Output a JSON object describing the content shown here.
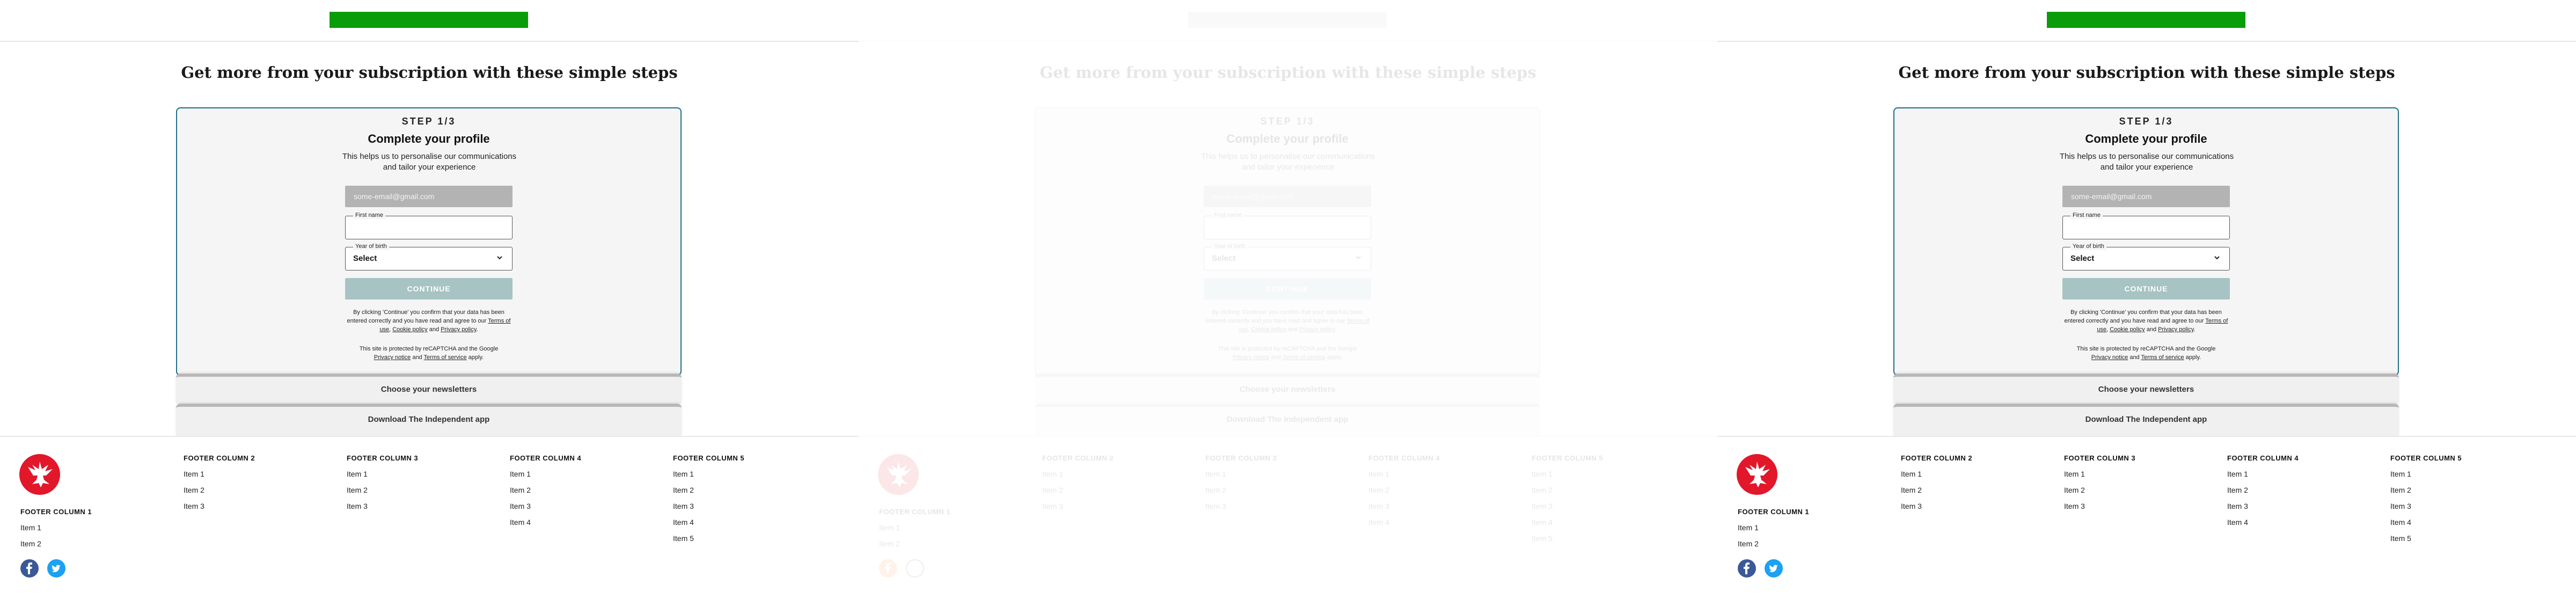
{
  "panels": [
    {
      "heading": "Get more from your subscription with these simple steps",
      "step_label": "STEP 1/3",
      "card_title": "Complete your profile",
      "card_subtitle": "This helps us to personalise our communications and tailor your experience",
      "email_value": "some-email@gmail.com",
      "first_name_label": "First name",
      "first_name_value": "",
      "year_label": "Year of birth",
      "year_value": "Select",
      "continue_label": "CONTINUE",
      "legal_prefix": "By clicking 'Continue' you confirm that your data has been entered correctly and you have read and agree to our ",
      "legal_terms": "Terms of use",
      "legal_sep1": ", ",
      "legal_cookie": "Cookie policy",
      "legal_and": " and ",
      "legal_privacy": "Privacy policy",
      "legal_end": ".",
      "captcha_prefix": "This site is protected by reCAPTCHA and the Google ",
      "captcha_privacy": "Privacy notice",
      "captcha_and": " and ",
      "captcha_terms": "Terms of service",
      "captcha_end": " apply.",
      "accordion_newsletters": "Choose your newsletters",
      "accordion_app": "Download The Independent app",
      "footer": {
        "col1": {
          "title": "FOOTER COLUMN 1",
          "items": [
            "Item 1",
            "Item 2"
          ]
        },
        "col2": {
          "title": "FOOTER COLUMN 2",
          "items": [
            "Item 1",
            "Item 2",
            "Item 3"
          ]
        },
        "col3": {
          "title": "FOOTER COLUMN 3",
          "items": [
            "Item 1",
            "Item 2",
            "Item 3"
          ]
        },
        "col4": {
          "title": "FOOTER COLUMN 4",
          "items": [
            "Item 1",
            "Item 2",
            "Item 3",
            "Item 4"
          ]
        },
        "col5": {
          "title": "FOOTER COLUMN 5",
          "items": [
            "Item 1",
            "Item 2",
            "Item 3",
            "Item 4",
            "Item 5"
          ]
        }
      }
    },
    {
      "heading": "Get more from your subscription with these simple steps",
      "step_label": "STEP 1/3",
      "card_title": "Complete your profile",
      "card_subtitle": "This helps us to personalise our communications and tailor your experience",
      "email_value": "some-email@gmail.com",
      "first_name_label": "First name",
      "first_name_value": "",
      "year_label": "Year of birth",
      "year_value": "Select",
      "continue_label": "CONTINUE",
      "legal_prefix": "By clicking 'Continue' you confirm that your data has been entered correctly and you have read and agree to our ",
      "legal_terms": "Terms of use",
      "legal_sep1": ", ",
      "legal_cookie": "Cookie policy",
      "legal_and": " and ",
      "legal_privacy": "Privacy policy",
      "legal_end": ".",
      "captcha_prefix": "This site is protected by reCAPTCHA and the Google ",
      "captcha_privacy": "Privacy notice",
      "captcha_and": " and ",
      "captcha_terms": "Terms of service",
      "captcha_end": " apply.",
      "accordion_newsletters": "Choose your newsletters",
      "accordion_app": "Download The Independent app",
      "footer": {
        "col1": {
          "title": "FOOTER COLUMN 1",
          "items": [
            "Item 1",
            "Item 2"
          ]
        },
        "col2": {
          "title": "FOOTER COLUMN 2",
          "items": [
            "Item 1",
            "Item 2",
            "Item 3"
          ]
        },
        "col3": {
          "title": "FOOTER COLUMN 3",
          "items": [
            "Item 1",
            "Item 2",
            "Item 3"
          ]
        },
        "col4": {
          "title": "FOOTER COLUMN 4",
          "items": [
            "Item 1",
            "Item 2",
            "Item 3",
            "Item 4"
          ]
        },
        "col5": {
          "title": "FOOTER COLUMN 5",
          "items": [
            "Item 1",
            "Item 2",
            "Item 3",
            "Item 4",
            "Item 5"
          ]
        }
      }
    },
    {
      "heading": "Get more from your subscription with these simple steps",
      "step_label": "STEP 1/3",
      "card_title": "Complete your profile",
      "card_subtitle": "This helps us to personalise our communications and tailor your experience",
      "email_value": "some-email@gmail.com",
      "first_name_label": "First name",
      "first_name_value": "",
      "year_label": "Year of birth",
      "year_value": "Select",
      "continue_label": "CONTINUE",
      "legal_prefix": "By clicking 'Continue' you confirm that your data has been entered correctly and you have read and agree to our ",
      "legal_terms": "Terms of use",
      "legal_sep1": ", ",
      "legal_cookie": "Cookie policy",
      "legal_and": " and ",
      "legal_privacy": "Privacy policy",
      "legal_end": ".",
      "captcha_prefix": "This site is protected by reCAPTCHA and the Google ",
      "captcha_privacy": "Privacy notice",
      "captcha_and": " and ",
      "captcha_terms": "Terms of service",
      "captcha_end": " apply.",
      "accordion_newsletters": "Choose your newsletters",
      "accordion_app": "Download The Independent app",
      "footer": {
        "col1": {
          "title": "FOOTER COLUMN 1",
          "items": [
            "Item 1",
            "Item 2"
          ]
        },
        "col2": {
          "title": "FOOTER COLUMN 2",
          "items": [
            "Item 1",
            "Item 2",
            "Item 3"
          ]
        },
        "col3": {
          "title": "FOOTER COLUMN 3",
          "items": [
            "Item 1",
            "Item 2",
            "Item 3"
          ]
        },
        "col4": {
          "title": "FOOTER COLUMN 4",
          "items": [
            "Item 1",
            "Item 2",
            "Item 3",
            "Item 4"
          ]
        },
        "col5": {
          "title": "FOOTER COLUMN 5",
          "items": [
            "Item 1",
            "Item 2",
            "Item 3",
            "Item 4",
            "Item 5"
          ]
        }
      }
    }
  ],
  "colors": {
    "brand_green": "#0a9d0a",
    "card_border": "#1f6f86",
    "continue_disabled": "#a7c3c3",
    "logo_red": "#e2172a",
    "facebook": "#3b5998",
    "twitter": "#1da1f2"
  },
  "icons": [
    "independent-eagle-logo-icon",
    "chevron-down-icon",
    "facebook-icon",
    "twitter-icon"
  ]
}
